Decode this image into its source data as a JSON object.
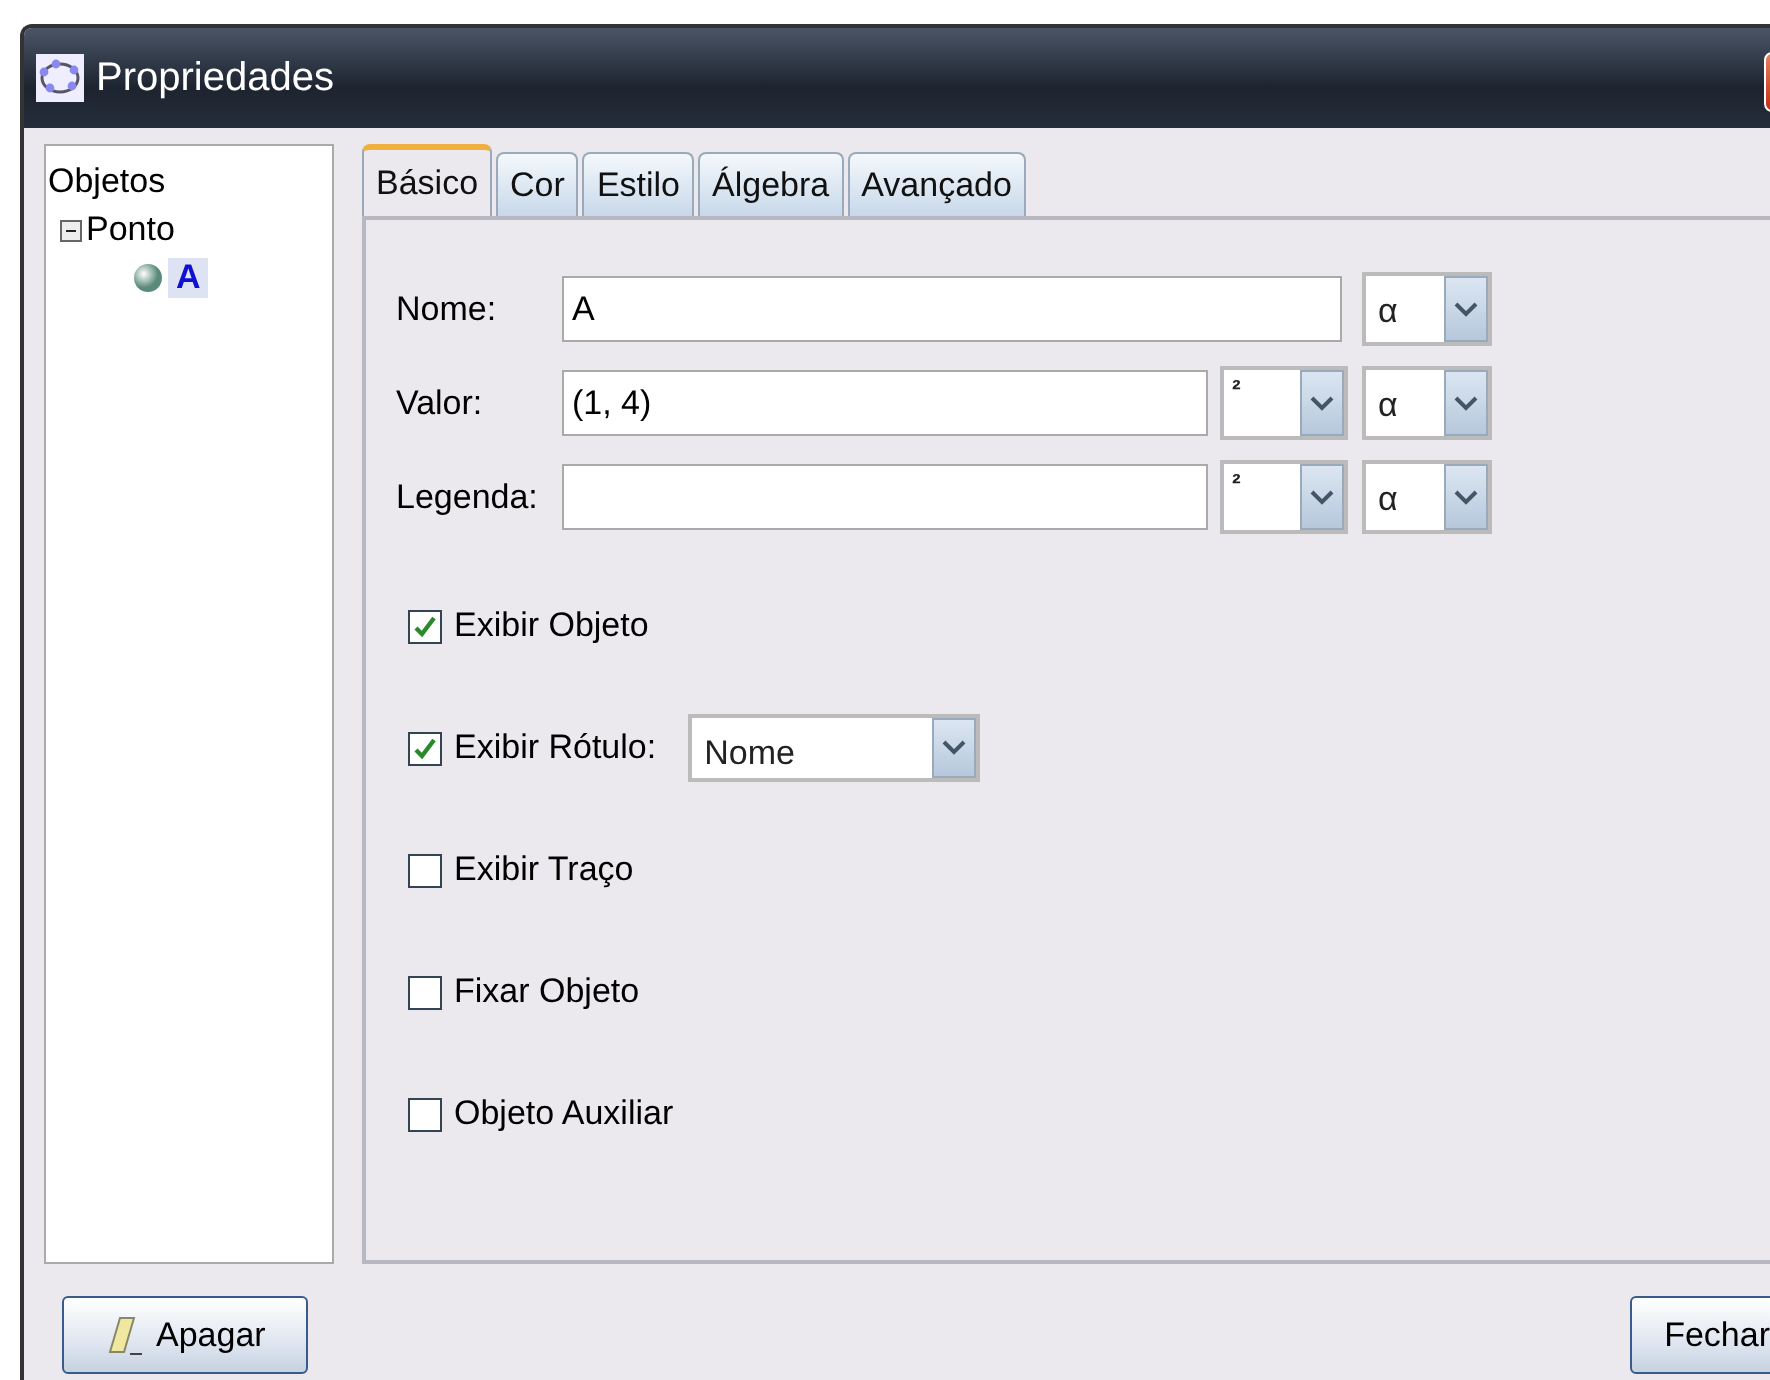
{
  "window": {
    "title": "Propriedades"
  },
  "tree": {
    "label": "Objetos",
    "children": [
      {
        "label": "Ponto",
        "expanded": true,
        "children": [
          {
            "label": "A",
            "selected": true
          }
        ]
      }
    ]
  },
  "tabs": [
    {
      "label": "Básico",
      "selected": true
    },
    {
      "label": "Cor",
      "selected": false
    },
    {
      "label": "Estilo",
      "selected": false
    },
    {
      "label": "Álgebra",
      "selected": false
    },
    {
      "label": "Avançado",
      "selected": false
    }
  ],
  "fields": [
    {
      "label": "Nome:",
      "value": "A",
      "symbol": "α"
    },
    {
      "label": "Valor:",
      "value": "(1, 4)",
      "format": "²",
      "symbol": "α"
    },
    {
      "label": "Legenda:",
      "format": "²",
      "symbol": "α"
    }
  ],
  "options": [
    {
      "label": "Exibir Objeto",
      "checked": true
    },
    {
      "label": "Exibir Rótulo:",
      "checked": true,
      "select": "Nome"
    },
    {
      "label": "Exibir Traço",
      "checked": false
    },
    {
      "label": "Fixar Objeto",
      "checked": false
    },
    {
      "label": "Objeto Auxiliar",
      "checked": false
    }
  ],
  "buttons": [
    {
      "label": "Apagar",
      "kind": "delete"
    },
    {
      "label": "Fechar",
      "kind": "close"
    }
  ]
}
